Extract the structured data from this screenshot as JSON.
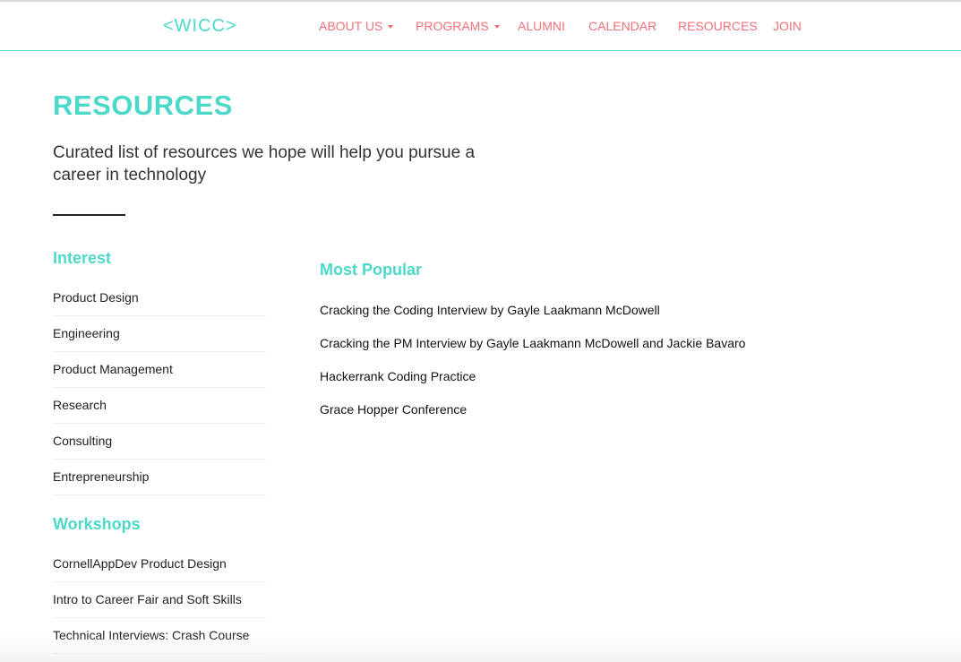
{
  "nav": {
    "logo": "<WICC>",
    "items": [
      {
        "label": "ABOUT US",
        "dropdown": true
      },
      {
        "label": "PROGRAMS",
        "dropdown": true
      },
      {
        "label": "ALUMNI",
        "dropdown": false
      },
      {
        "label": "CALENDAR",
        "dropdown": false
      },
      {
        "label": "RESOURCES",
        "dropdown": false
      },
      {
        "label": "JOIN",
        "dropdown": false
      }
    ]
  },
  "page": {
    "title": "RESOURCES",
    "subtitle": "Curated list of resources we hope will help you pursue a career in technology"
  },
  "interest": {
    "title": "Interest",
    "items": [
      "Product Design",
      "Engineering",
      "Product Management",
      "Research",
      "Consulting",
      "Entrepreneurship"
    ]
  },
  "workshops": {
    "title": "Workshops",
    "items": [
      "CornellAppDev Product Design",
      "Intro to Career Fair and Soft Skills",
      "Technical Interviews: Crash Course"
    ]
  },
  "popular": {
    "title": "Most Popular",
    "items": [
      "Cracking the Coding Interview by Gayle Laakmann McDowell",
      "Cracking the PM Interview by Gayle Laakmann McDowell and Jackie Bavaro",
      "Hackerrank Coding Practice",
      "Grace Hopper Conference"
    ]
  },
  "colors": {
    "accent": "#4dd9c9",
    "nav_link": "#f0707a",
    "text": "#222222"
  }
}
